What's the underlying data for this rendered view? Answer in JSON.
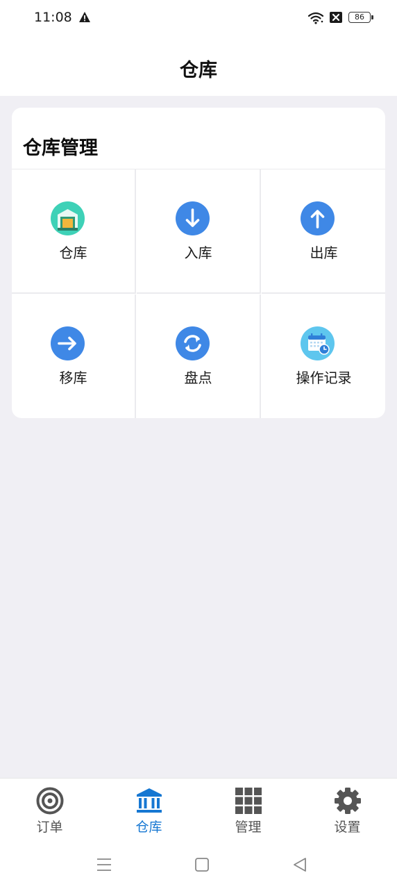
{
  "status_bar": {
    "time": "11:08",
    "battery": "86",
    "icons": [
      "warning-icon",
      "wifi-icon",
      "no-sim-icon",
      "battery-icon"
    ]
  },
  "header": {
    "title": "仓库"
  },
  "card": {
    "title": "仓库管理",
    "items": [
      {
        "label": "仓库",
        "icon": "warehouse-icon",
        "color": "#3ed1b7"
      },
      {
        "label": "入库",
        "icon": "arrow-down-icon",
        "color": "#3f88e6"
      },
      {
        "label": "出库",
        "icon": "arrow-up-icon",
        "color": "#3f88e6"
      },
      {
        "label": "移库",
        "icon": "arrow-right-icon",
        "color": "#3f88e6"
      },
      {
        "label": "盘点",
        "icon": "refresh-icon",
        "color": "#3f88e6"
      },
      {
        "label": "操作记录",
        "icon": "calendar-clock-icon",
        "color": "#5ec6ee"
      }
    ]
  },
  "bottom_nav": {
    "active_color": "#1677d2",
    "items": [
      {
        "label": "订单",
        "icon": "target-icon",
        "active": false
      },
      {
        "label": "仓库",
        "icon": "bank-icon",
        "active": true
      },
      {
        "label": "管理",
        "icon": "grid-icon",
        "active": false
      },
      {
        "label": "设置",
        "icon": "gear-icon",
        "active": false
      }
    ]
  },
  "system_nav": [
    "menu-icon",
    "home-icon",
    "back-icon"
  ]
}
